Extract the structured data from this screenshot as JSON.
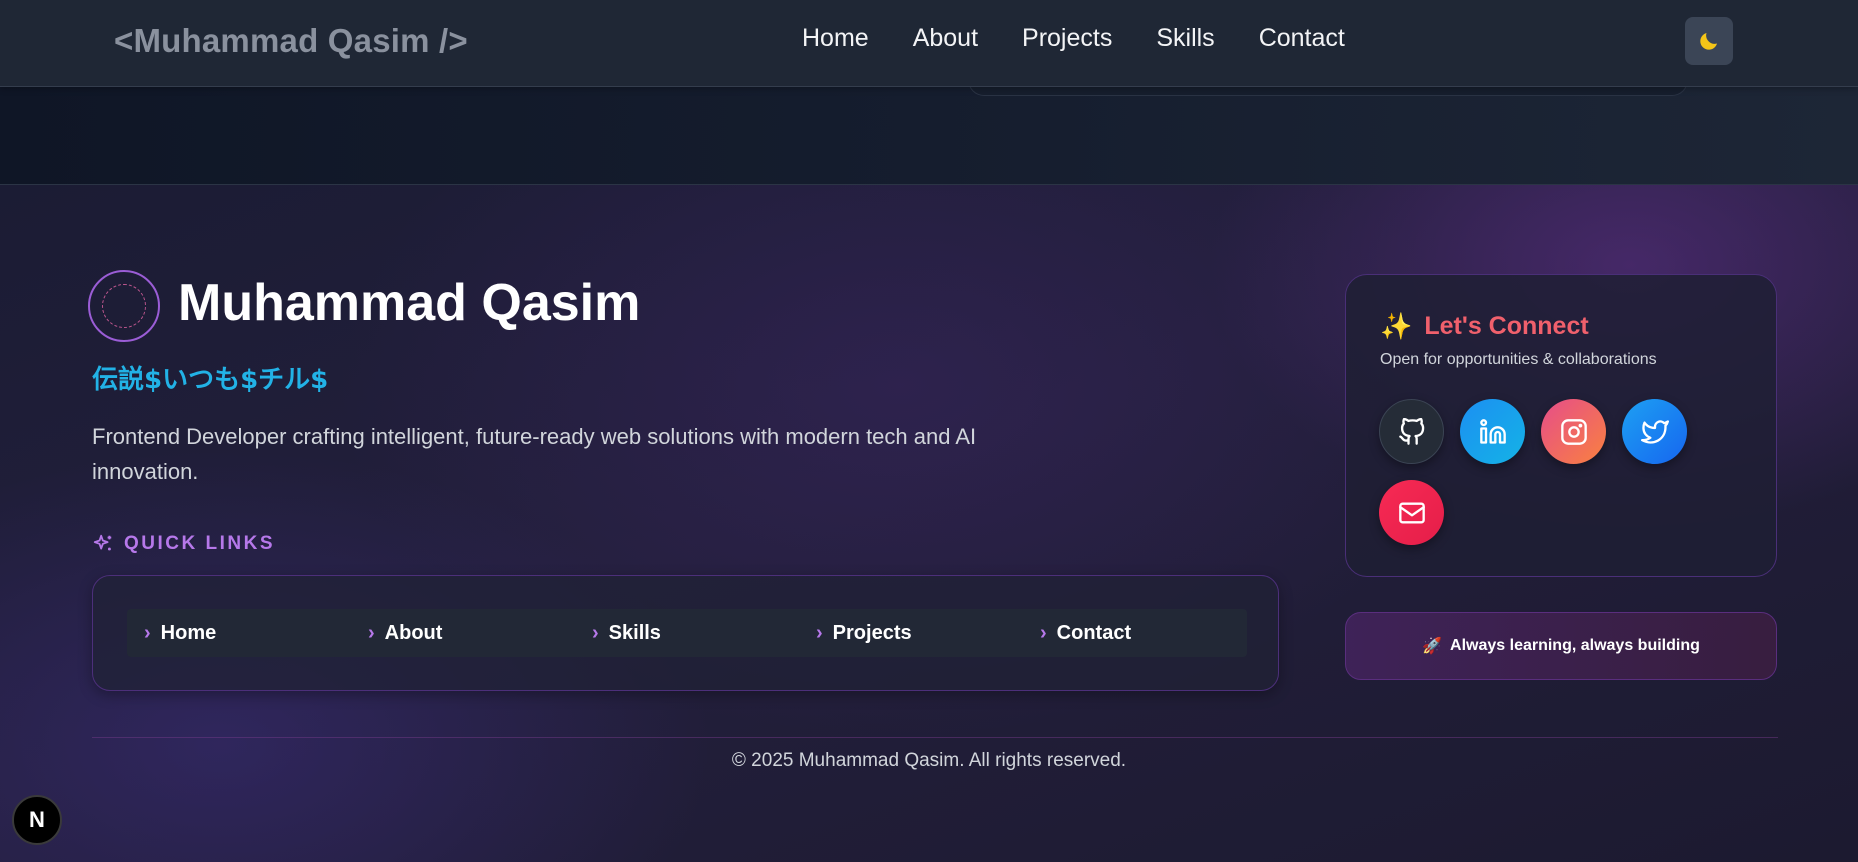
{
  "navbar": {
    "brand": "<Muhammad Qasim />",
    "links": [
      "Home",
      "About",
      "Projects",
      "Skills",
      "Contact"
    ],
    "theme_icon": "moon-icon"
  },
  "footer": {
    "name": "Muhammad Qasim",
    "tagline": "伝説$いつも$チル$",
    "description": "Frontend Developer crafting intelligent, future-ready web solutions with modern tech and AI innovation.",
    "quick_links_title": "QUICK LINKS",
    "quick_links": [
      "Home",
      "About",
      "Skills",
      "Projects",
      "Contact"
    ],
    "connect": {
      "title": "Let's Connect",
      "subtitle": "Open for opportunities & collaborations",
      "socials": [
        "github-icon",
        "linkedin-icon",
        "instagram-icon",
        "twitter-icon",
        "mail-icon"
      ]
    },
    "learning_badge": "Always learning, always building",
    "copyright": "© 2025 Muhammad Qasim. All rights reserved."
  },
  "dev_badge": "N",
  "colors": {
    "accent_purple": "#b678ea",
    "connect_title": "#f0606c",
    "tagline": "#22b2e6"
  }
}
